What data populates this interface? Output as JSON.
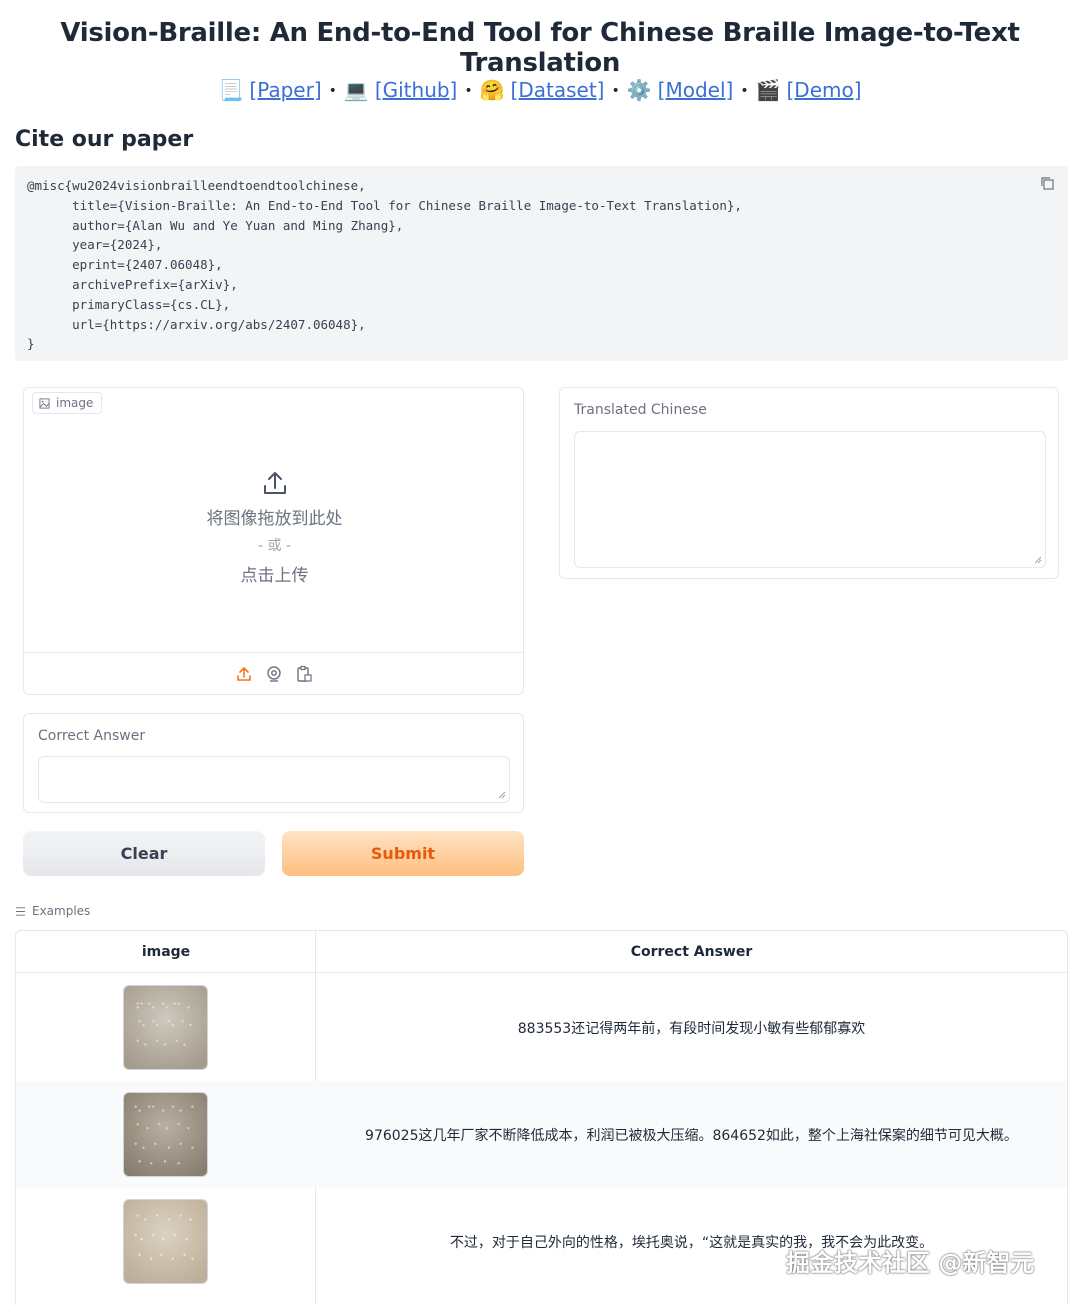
{
  "header": {
    "title": "Vision-Braille: An End-to-End Tool for Chinese Braille Image-to-Text Translation",
    "links": [
      {
        "emoji": "📃",
        "label": "[Paper]"
      },
      {
        "emoji": "💻",
        "label": "[Github]"
      },
      {
        "emoji": "🤗",
        "label": "[Dataset]"
      },
      {
        "emoji": "⚙️",
        "label": "[Model]"
      },
      {
        "emoji": "🎬",
        "label": "[Demo]"
      }
    ],
    "separator": "•"
  },
  "cite": {
    "heading": "Cite our paper",
    "code": "@misc{wu2024visionbrailleendtoendtoolchinese,\n      title={Vision-Braille: An End-to-End Tool for Chinese Braille Image-to-Text Translation},\n      author={Alan Wu and Ye Yuan and Ming Zhang},\n      year={2024},\n      eprint={2407.06048},\n      archivePrefix={arXiv},\n      primaryClass={cs.CL},\n      url={https://arxiv.org/abs/2407.06048},\n}"
  },
  "image_input": {
    "label": "image",
    "drop_text": "将图像拖放到此处",
    "or_text": "- 或 -",
    "click_text": "点击上传"
  },
  "output": {
    "label": "Translated Chinese",
    "value": ""
  },
  "answer": {
    "label": "Correct Answer",
    "value": ""
  },
  "buttons": {
    "clear": "Clear",
    "submit": "Submit"
  },
  "examples": {
    "label": "Examples",
    "headers": [
      "image",
      "Correct Answer"
    ],
    "rows": [
      {
        "answer": "883553还记得两年前，有段时间发现小敏有些郁郁寡欢"
      },
      {
        "answer": "976025这几年厂家不断降低成本，利润已被极大压缩。864652如此，整个上海社保案的细节可见大概。"
      },
      {
        "answer": "不过，对于自己外向的性格，埃托奥说，“这就是真实的我，我不会为此改变。"
      }
    ]
  },
  "watermark": "掘金技术社区 @新智元",
  "colors": {
    "link": "#3b6fd6",
    "submit_text": "#ea580c",
    "submit_bg": "#fdbf80",
    "code_bg": "#f3f4f6"
  }
}
